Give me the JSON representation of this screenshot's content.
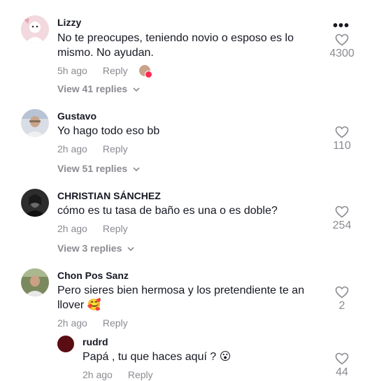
{
  "comments": [
    {
      "username": "Lizzy",
      "text": "No te preocupes, teniendo novio o esposo es lo mismo. No ayudan.",
      "time": "5h ago",
      "reply_label": "Reply",
      "view_replies": "View 41 replies",
      "likes": "4300"
    },
    {
      "username": "Gustavo",
      "text": "Yo hago todo eso bb",
      "time": "2h ago",
      "reply_label": "Reply",
      "view_replies": "View 51 replies",
      "likes": "110"
    },
    {
      "username": "CHRISTIAN SÁNCHEZ",
      "text": "cómo es tu tasa de baño es una o es doble?",
      "time": "2h ago",
      "reply_label": "Reply",
      "view_replies": "View 3 replies",
      "likes": "254"
    },
    {
      "username": "Chon Pos Sanz",
      "text": "Pero sieres bien hermosa y los pretendiente te an llover 🥰",
      "time": "2h ago",
      "reply_label": "Reply",
      "likes": "2"
    }
  ],
  "reply": {
    "username": "rudrd",
    "text": "Papá , tu que haces aquí ? 😮",
    "time": "2h ago",
    "reply_label": "Reply",
    "likes": "44"
  },
  "more_label": "•••",
  "colors": {
    "text": "#161823",
    "muted": "#8a8b91",
    "accent": "#fe2c55"
  }
}
